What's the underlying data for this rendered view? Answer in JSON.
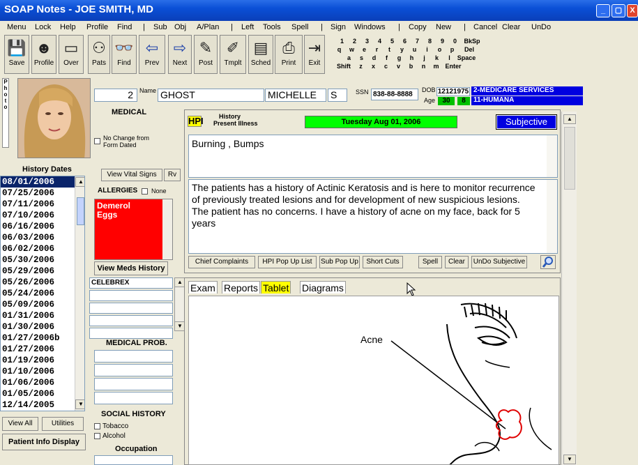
{
  "window": {
    "title": "SOAP Notes -  JOE SMITH, MD",
    "min": "_",
    "max": "▢",
    "close": "X"
  },
  "menu": [
    "Menu",
    "Lock",
    "Help",
    "Profile",
    "Find",
    "Sub",
    "Obj",
    "A/Plan",
    "Left",
    "Tools",
    "Spell",
    "Sign",
    "Windows",
    "Copy",
    "New",
    "Cancel",
    "Clear",
    "UnDo"
  ],
  "toolbar": [
    "Save",
    "Profile",
    "Over",
    "Pats",
    "Find",
    "Prev",
    "Next",
    "Post",
    "Tmplt",
    "Sched",
    "Print",
    "Exit"
  ],
  "keyboard": {
    "row1": [
      "1",
      "2",
      "3",
      "4",
      "5",
      "6",
      "7",
      "8",
      "9",
      "0",
      "BkSp"
    ],
    "row2": [
      "q",
      "w",
      "e",
      "r",
      "t",
      "y",
      "u",
      "i",
      "o",
      "p",
      "Del"
    ],
    "row3": [
      "a",
      "s",
      "d",
      "f",
      "g",
      "h",
      "j",
      "k",
      "l",
      "Space"
    ],
    "row4": [
      "Shift",
      "z",
      "x",
      "c",
      "v",
      "b",
      "n",
      "m",
      "Enter"
    ]
  },
  "patient": {
    "photo_label": "Photo",
    "number": "2",
    "name_label": "Name",
    "last": "GHOST",
    "first": "MICHELLE",
    "mi": "S",
    "ssn_label": "SSN",
    "ssn": "838-88-8888",
    "dob_label": "DOB",
    "dob": "12121975",
    "age_label": "Age",
    "age": "30",
    "age2": "8",
    "insurance1": "2-MEDICARE SERVICES",
    "insurance2": "11-HUMANA"
  },
  "left": {
    "history_dates_label": "History Dates",
    "dates": [
      "08/01/2006",
      "07/25/2006",
      "07/11/2006",
      "07/10/2006",
      "06/16/2006",
      "06/03/2006",
      "06/02/2006",
      "05/30/2006",
      "05/29/2006",
      "05/26/2006",
      "05/24/2006",
      "05/09/2006",
      "01/31/2006",
      "01/30/2006",
      "01/27/2006b",
      "01/27/2006",
      "01/19/2006",
      "01/10/2006",
      "01/06/2006",
      "01/05/2006",
      "12/14/2005"
    ],
    "view_all": "View All",
    "utilities": "Utilities",
    "patient_info": "Patient Info Display"
  },
  "medical": {
    "header": "MEDICAL",
    "no_change": "No Change from\nForm Dated",
    "vital_signs": "View Vital Signs",
    "rv": "Rv",
    "allergies_label": "ALLERGIES",
    "none_label": "None",
    "allergies": [
      "Demerol",
      "Eggs"
    ],
    "meds_history": "View Meds History",
    "meds": [
      "CELEBREX",
      "",
      "",
      "",
      ""
    ],
    "med_prob_label": "MEDICAL PROB.",
    "social_label": "SOCIAL HISTORY",
    "tobacco": "Tobacco",
    "alcohol": "Alcohol",
    "occupation_label": "Occupation"
  },
  "hpi": {
    "tag": "HPI",
    "title1": "History",
    "title2": "Present Illness",
    "date": "Tuesday Aug 01, 2006",
    "section": "Subjective",
    "complaint": "Burning , Bumps",
    "narrative": "The patients has a history of Actinic Keratosis and is here to monitor recurrence of previously treated lesions and for development of new suspicious lesions.\nThe patient has no concerns. I have a history of acne on my face, back for 5 years",
    "buttons": [
      "Chief Complaints",
      "HPI Pop Up List",
      "Sub Pop Up",
      "Short Cuts",
      "Spell",
      "Clear",
      "UnDo Subjective"
    ]
  },
  "tabs": [
    "Exam",
    "Reports",
    "Tablet",
    "Diagrams"
  ],
  "diagram": {
    "annotation": "Acne"
  }
}
